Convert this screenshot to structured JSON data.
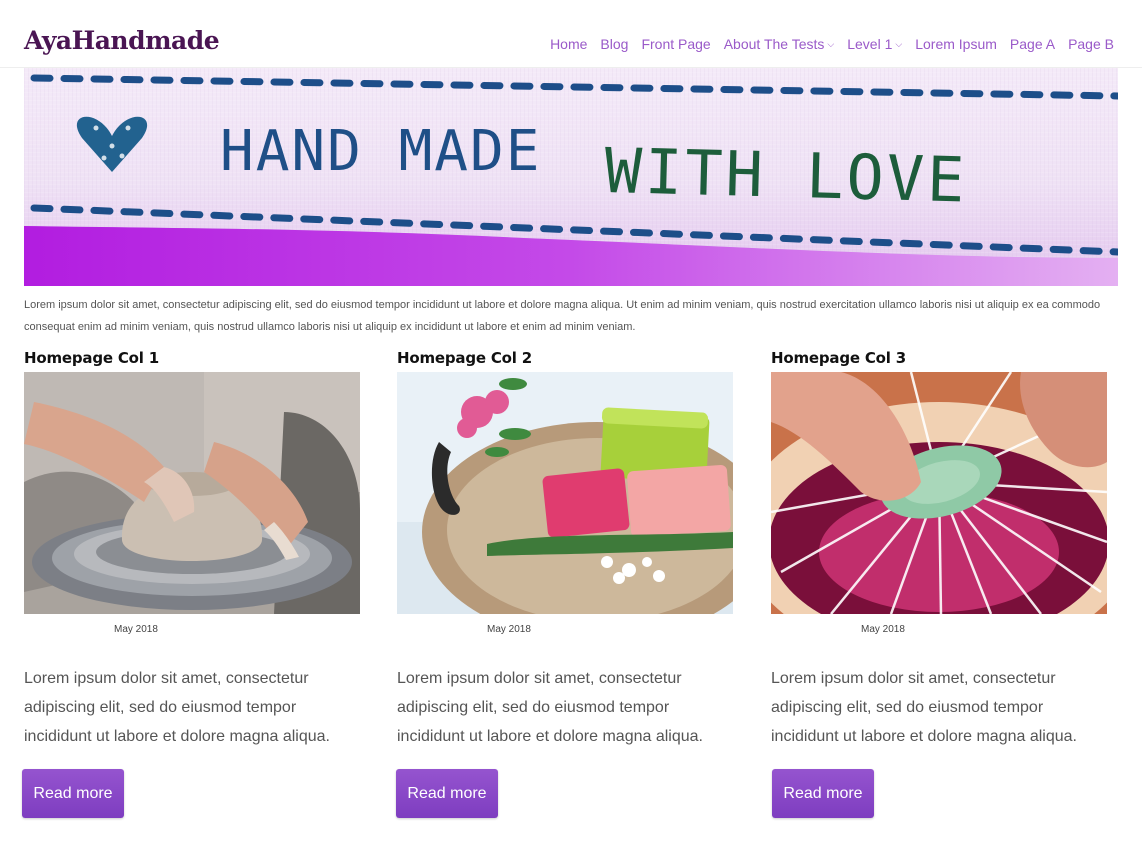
{
  "site": {
    "logo": "AyaHandmade"
  },
  "nav": {
    "items": [
      {
        "label": "Home",
        "dropdown": false
      },
      {
        "label": "Blog",
        "dropdown": false
      },
      {
        "label": "Front Page",
        "dropdown": false
      },
      {
        "label": "About The Tests",
        "dropdown": true
      },
      {
        "label": "Level 1",
        "dropdown": true
      },
      {
        "label": "Lorem Ipsum",
        "dropdown": false
      },
      {
        "label": "Page A",
        "dropdown": false
      },
      {
        "label": "Page B",
        "dropdown": false
      }
    ]
  },
  "hero": {
    "banner_text_left": "HAND MADE",
    "banner_text_right": "WITH LOVE"
  },
  "intro": {
    "text": "Lorem ipsum dolor sit amet, consectetur adipiscing elit, sed do eiusmod tempor incididunt ut labore et dolore magna aliqua. Ut enim ad minim veniam, quis nostrud exercitation ullamco laboris nisi ut aliquip ex ea commodo consequat enim ad minim veniam, quis nostrud ullamco laboris nisi ut aliquip ex incididunt ut labore et enim ad minim veniam."
  },
  "columns": [
    {
      "title": "Homepage Col 1",
      "date": "May 2018",
      "excerpt": "Lorem ipsum dolor sit amet, consectetur adipiscing elit, sed do eiusmod tempor incididunt ut labore et dolore magna aliqua.",
      "button": "Read more"
    },
    {
      "title": "Homepage Col 2",
      "date": "May 2018",
      "excerpt": "Lorem ipsum dolor sit amet, consectetur adipiscing elit, sed do eiusmod tempor incididunt ut labore et dolore magna aliqua.",
      "button": "Read more"
    },
    {
      "title": "Homepage Col 3",
      "date": "May 2018",
      "excerpt": "Lorem ipsum dolor sit amet, consectetur adipiscing elit, sed do eiusmod tempor incididunt ut labore et dolore magna aliqua.",
      "button": "Read more"
    }
  ],
  "colors": {
    "accent": "#9a5ac9",
    "logo": "#4a1553",
    "button": "#8a48c8"
  }
}
